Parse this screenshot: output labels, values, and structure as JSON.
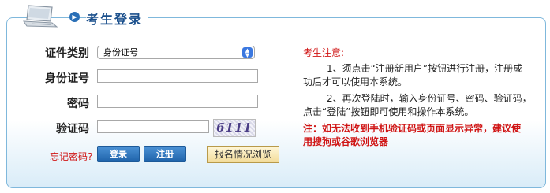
{
  "header": {
    "title": "考生登录"
  },
  "form": {
    "id_type_label": "证件类别",
    "id_type_selected": "身份证号",
    "id_number_label": "身份证号",
    "id_number_value": "",
    "password_label": "密码",
    "password_value": "",
    "captcha_label": "验证码",
    "captcha_value": "",
    "captcha_image_text": "6111"
  },
  "actions": {
    "forgot_password": "忘记密码?",
    "login": "登录",
    "register": "注册",
    "browse": "报名情况浏览"
  },
  "notice": {
    "title": "考生注意:",
    "item1": "1、须点击“注册新用户”按钮进行注册，注册成功后才可以使用本系统。",
    "item2": "2、再次登陆时，输入身份证号、密码、验证码，点击“登陆”按钮即可使用和操作本系统。",
    "warning": "注：如无法收到手机验证码或页面显示异常，建议使用搜狗或谷歌浏览器"
  },
  "colors": {
    "accent": "#1a4f8c",
    "warning": "#d01515",
    "button_blue": "#1f63aa"
  }
}
